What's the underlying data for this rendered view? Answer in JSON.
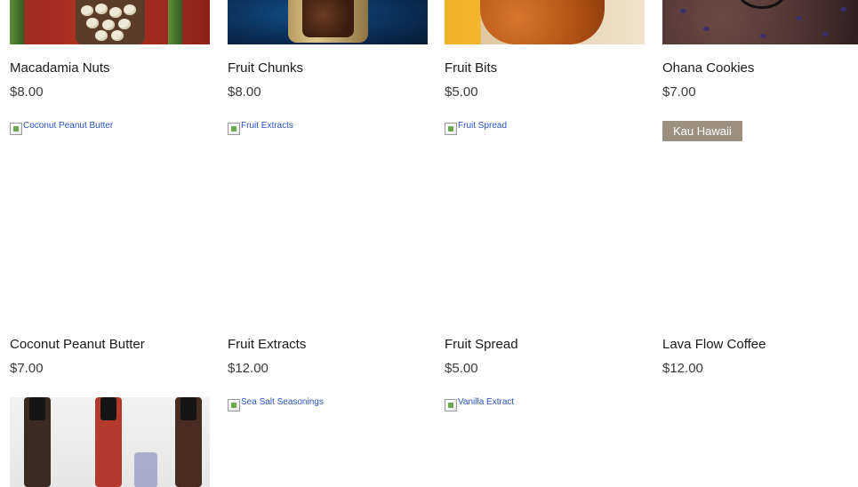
{
  "products": [
    {
      "name": "Macadamia Nuts",
      "price": "$8.00"
    },
    {
      "name": "Fruit Chunks",
      "price": "$8.00"
    },
    {
      "name": "Fruit Bits",
      "price": "$5.00"
    },
    {
      "name": "Ohana Cookies",
      "price": "$7.00"
    },
    {
      "name": "Coconut Peanut Butter",
      "price": "$7.00",
      "alt": "Coconut Peanut Butter"
    },
    {
      "name": "Fruit Extracts",
      "price": "$12.00",
      "alt": "Fruit Extracts"
    },
    {
      "name": "Fruit Spread",
      "price": "$5.00",
      "alt": "Fruit Spread"
    },
    {
      "name": "Lava Flow Coffee",
      "price": "$12.00",
      "badge": "Kau Hawaii"
    },
    {
      "name": "",
      "price": ""
    },
    {
      "alt": "Sea Salt Seasonings"
    },
    {
      "alt": "Vanilla Extract"
    }
  ],
  "colors": {
    "badge": "#9d9080",
    "text": "#1a1a1a",
    "price": "#3a3a3a",
    "alt_text": "#2a52be"
  },
  "icons": {
    "broken_image": "broken-image-icon"
  }
}
